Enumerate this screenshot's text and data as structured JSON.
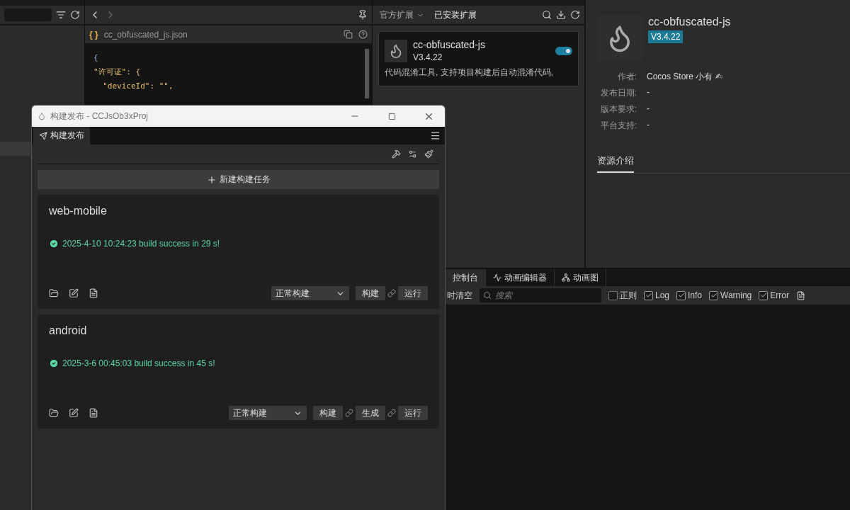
{
  "inspector": {
    "icon_text": "{ }",
    "file_name": "cc_obfuscated_js.json",
    "code_lines": [
      {
        "kind": "brace",
        "text": "{"
      },
      {
        "kind": "key",
        "text": "\"许可证\": {"
      },
      {
        "kind": "pair",
        "text": "  \"deviceId\": \"\","
      }
    ]
  },
  "extensions": {
    "tabs": [
      {
        "label": "官方扩展",
        "selected": false
      },
      {
        "label": "已安装扩展",
        "selected": true
      }
    ],
    "items": [
      {
        "name": "cc-obfuscated-js",
        "version": "V3.4.22",
        "description": "代码混淆工具, 支持项目构建后自动混淆代码,",
        "on": true
      }
    ]
  },
  "details": {
    "name": "cc-obfuscated-js",
    "version": "V3.4.22",
    "fields": [
      {
        "label": "作者:",
        "value": "Cocos Store 小有 ✍"
      },
      {
        "label": "发布日期:",
        "value": "-"
      },
      {
        "label": "版本要求:",
        "value": "-"
      },
      {
        "label": "平台支持:",
        "value": "-"
      }
    ],
    "tabs": [
      {
        "label": "资源介绍",
        "selected": true
      }
    ]
  },
  "console": {
    "tabs": [
      {
        "label": "控制台",
        "selected": true
      },
      {
        "label": "动画编辑器",
        "selected": false
      },
      {
        "label": "动画图",
        "selected": false
      }
    ],
    "clear_label": "时清空",
    "search": {
      "placeholder": "搜索"
    },
    "filters": [
      {
        "label": "正则",
        "checked": false
      },
      {
        "label": "Log",
        "checked": true
      },
      {
        "label": "Info",
        "checked": true
      },
      {
        "label": "Warning",
        "checked": true
      },
      {
        "label": "Error",
        "checked": true
      }
    ]
  },
  "build_window": {
    "title": "构建发布 - CCJsOb3xProj",
    "tab": "构建发布",
    "new_task": "新建构建任务",
    "tasks": [
      {
        "platform": "web-mobile",
        "kind": "success",
        "status": "2025-4-10 10:24:23 build success in 29 s!",
        "mode": "正常构建",
        "actions": [
          "构建",
          "运行"
        ]
      },
      {
        "platform": "android",
        "kind": "success",
        "status": "2025-3-6 00:45:03 build success in 45 s!",
        "mode": "正常构建",
        "actions": [
          "构建",
          "生成",
          "运行"
        ]
      }
    ]
  }
}
